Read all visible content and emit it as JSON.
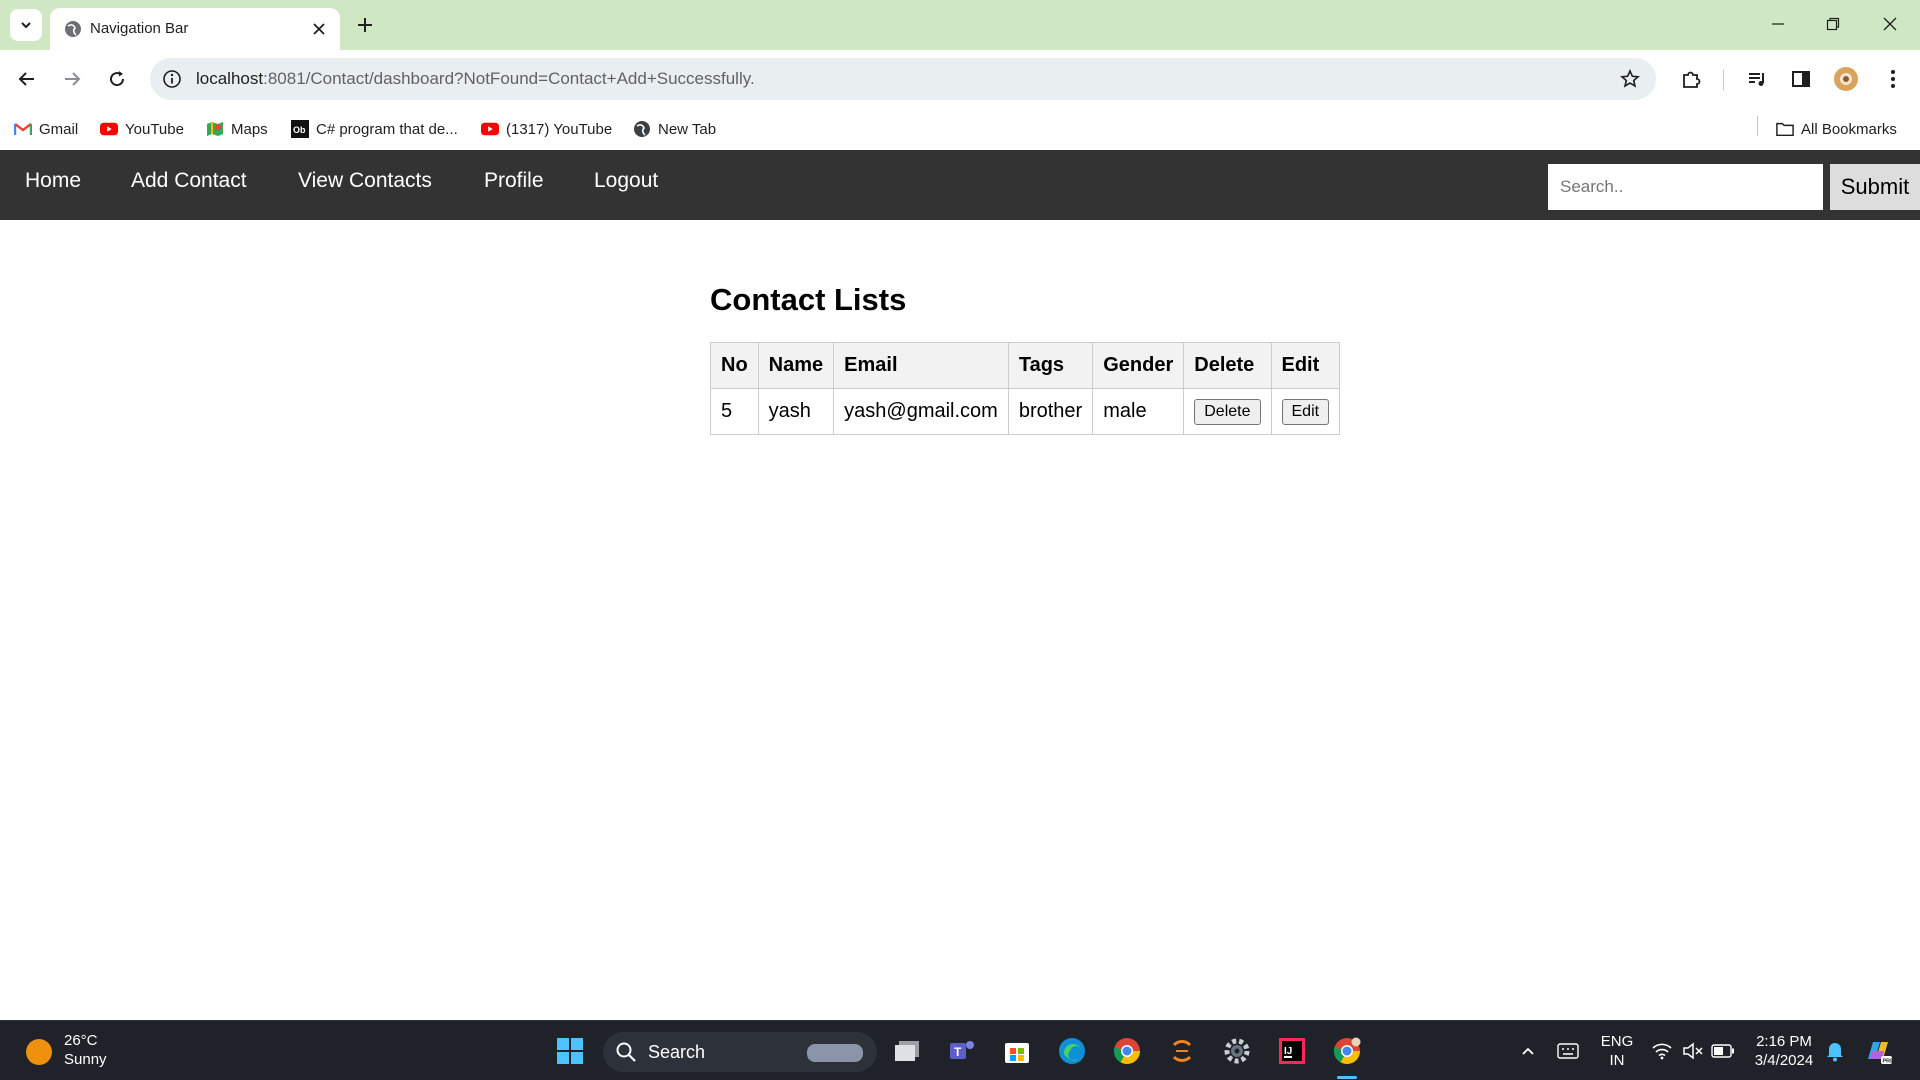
{
  "browser": {
    "tab_title": "Navigation Bar",
    "url_host": "localhost",
    "url_rest": ":8081/Contact/dashboard?NotFound=Contact+Add+Successfully.",
    "bookmarks": [
      {
        "label": "Gmail",
        "icon": "gmail-icon"
      },
      {
        "label": "YouTube",
        "icon": "youtube-icon"
      },
      {
        "label": "Maps",
        "icon": "maps-icon"
      },
      {
        "label": "C# program that de...",
        "icon": "ob-icon"
      },
      {
        "label": "(1317) YouTube",
        "icon": "youtube-icon"
      },
      {
        "label": "New Tab",
        "icon": "globe-icon"
      }
    ],
    "all_bookmarks": "All Bookmarks"
  },
  "nav": {
    "home": "Home",
    "add_contact": "Add Contact",
    "view_contacts": "View Contacts",
    "profile": "Profile",
    "logout": "Logout",
    "search_placeholder": "Search..",
    "submit": "Submit"
  },
  "main": {
    "heading": "Contact Lists",
    "columns": [
      "No",
      "Name",
      "Email",
      "Tags",
      "Gender",
      "Delete",
      "Edit"
    ],
    "rows": [
      {
        "no": "5",
        "name": "yash",
        "email": "yash@gmail.com",
        "tags": "brother",
        "gender": "male",
        "delete_label": "Delete",
        "edit_label": "Edit"
      }
    ]
  },
  "taskbar": {
    "temp": "26°C",
    "weather": "Sunny",
    "search": "Search",
    "lang": "ENG",
    "region": "IN",
    "time": "2:16 PM",
    "date": "3/4/2024"
  },
  "colors": {
    "tabstrip": "#cfe8c3",
    "navbar": "#333333",
    "taskbar": "#1f2329"
  }
}
